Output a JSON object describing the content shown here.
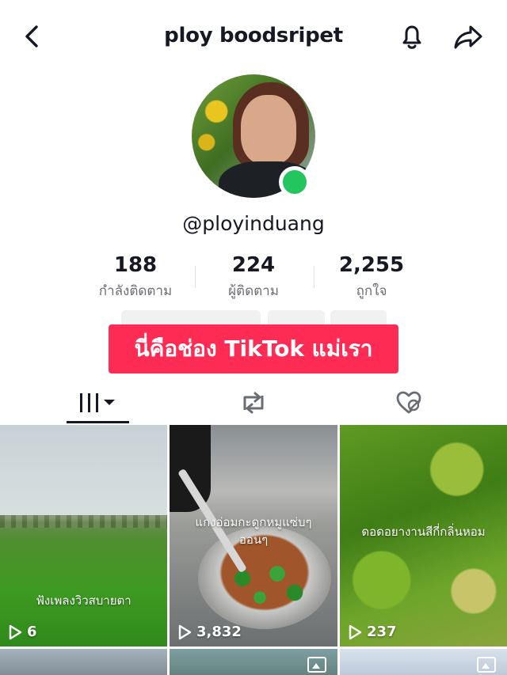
{
  "header": {
    "title": "ploy boodsripet",
    "back_icon": "chevron-left-icon",
    "bell_icon": "bell-icon",
    "share_icon": "share-arrow-icon"
  },
  "profile": {
    "username": "@ployinduang",
    "online": true,
    "online_color": "#22c55e"
  },
  "stats": [
    {
      "value": "188",
      "label": "กำลังติดตาม"
    },
    {
      "value": "224",
      "label": "ผู้ติดตาม"
    },
    {
      "value": "2,255",
      "label": "ถูกใจ"
    }
  ],
  "banner": {
    "text": "นี่คือช่อง TikTok แม่เรา",
    "color": "#fe2c55"
  },
  "tabs": [
    {
      "icon": "grid-videos-icon",
      "selected": true
    },
    {
      "icon": "repost-icon",
      "selected": false
    },
    {
      "icon": "liked-hidden-icon",
      "selected": false
    }
  ],
  "videos": [
    {
      "caption": "ฟังเพลงวิวสบายตา",
      "views": "6"
    },
    {
      "caption": "แกงอ่อมกะดูกหมูแซ่บๆ ออนๆ",
      "views": "3,832"
    },
    {
      "caption": "ดอดอยางานสีกี่กลิ่นหอม",
      "views": "237"
    }
  ]
}
